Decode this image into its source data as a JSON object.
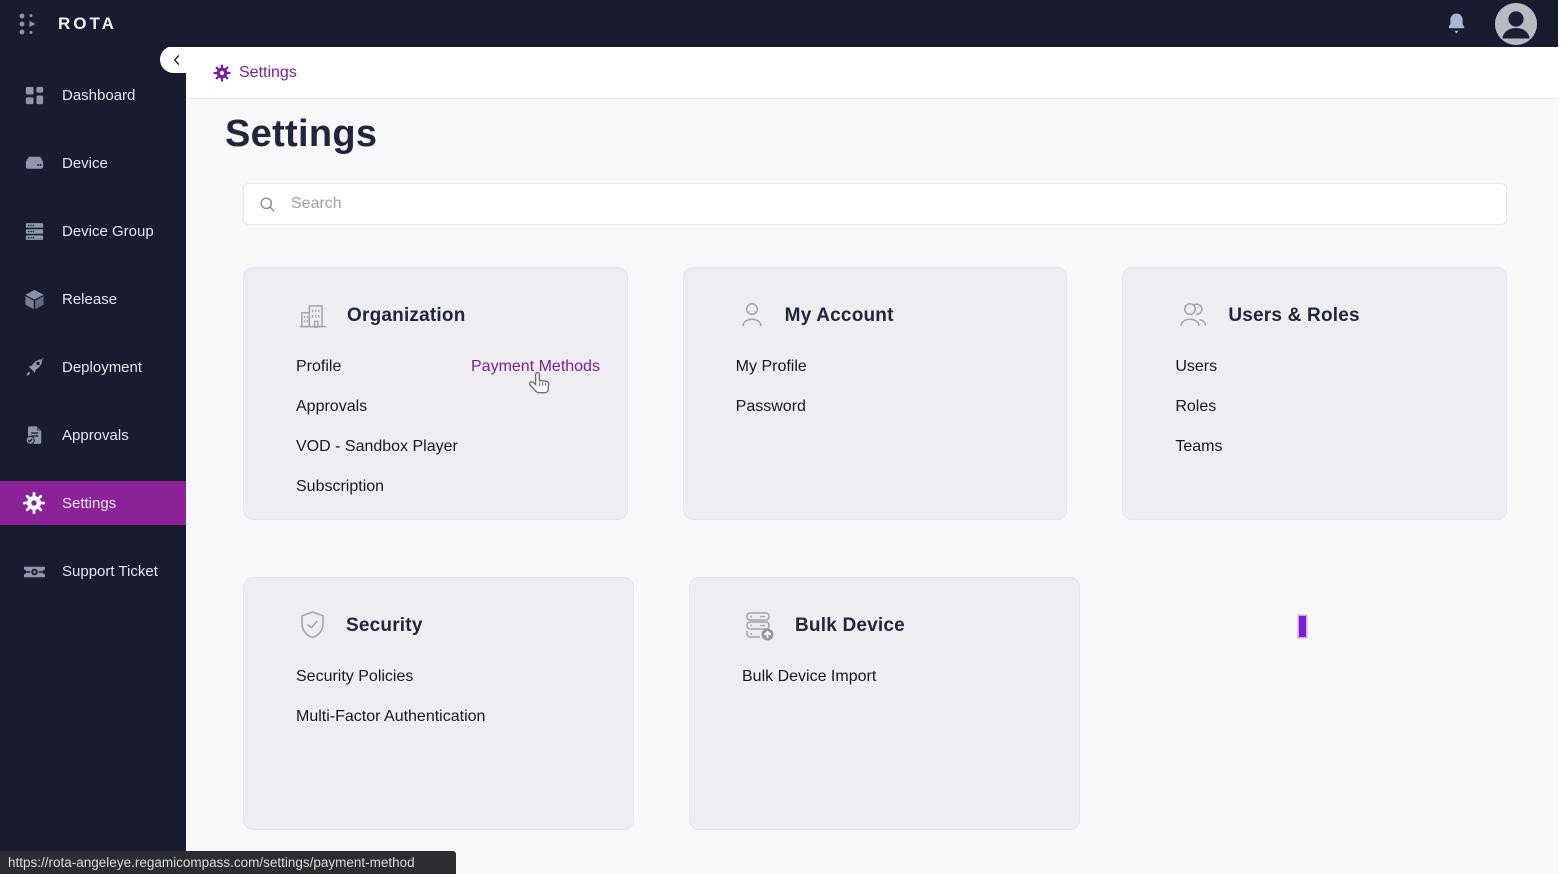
{
  "brand": "ROTA",
  "sidebar": {
    "items": [
      {
        "label": "Dashboard"
      },
      {
        "label": "Device"
      },
      {
        "label": "Device Group"
      },
      {
        "label": "Release"
      },
      {
        "label": "Deployment"
      },
      {
        "label": "Approvals"
      },
      {
        "label": "Settings"
      },
      {
        "label": "Support Ticket"
      }
    ],
    "active_item": "Settings"
  },
  "breadcrumb": {
    "label": "Settings"
  },
  "page": {
    "title": "Settings"
  },
  "search": {
    "placeholder": "Search"
  },
  "cards": {
    "organization": {
      "title": "Organization",
      "links_left": [
        "Profile",
        "Approvals",
        "VOD - Sandbox Player",
        "Subscription"
      ],
      "links_right": [
        "Payment Methods"
      ]
    },
    "my_account": {
      "title": "My Account",
      "links": [
        "My Profile",
        "Password"
      ]
    },
    "users_roles": {
      "title": "Users & Roles",
      "links": [
        "Users",
        "Roles",
        "Teams"
      ]
    },
    "security": {
      "title": "Security",
      "links": [
        "Security Policies",
        "Multi-Factor Authentication"
      ]
    },
    "bulk_device": {
      "title": "Bulk Device",
      "links": [
        "Bulk Device Import"
      ]
    }
  },
  "statusbar": {
    "url": "https://rota-angeleye.regamicompass.com/settings/payment-method"
  },
  "colors": {
    "accent": "#7e1d9f",
    "sidebar_active_bg": "#8a2298",
    "topbar_bg": "#181c2f",
    "card_bg": "#eeedf2",
    "caret": "#7b1fd6"
  }
}
